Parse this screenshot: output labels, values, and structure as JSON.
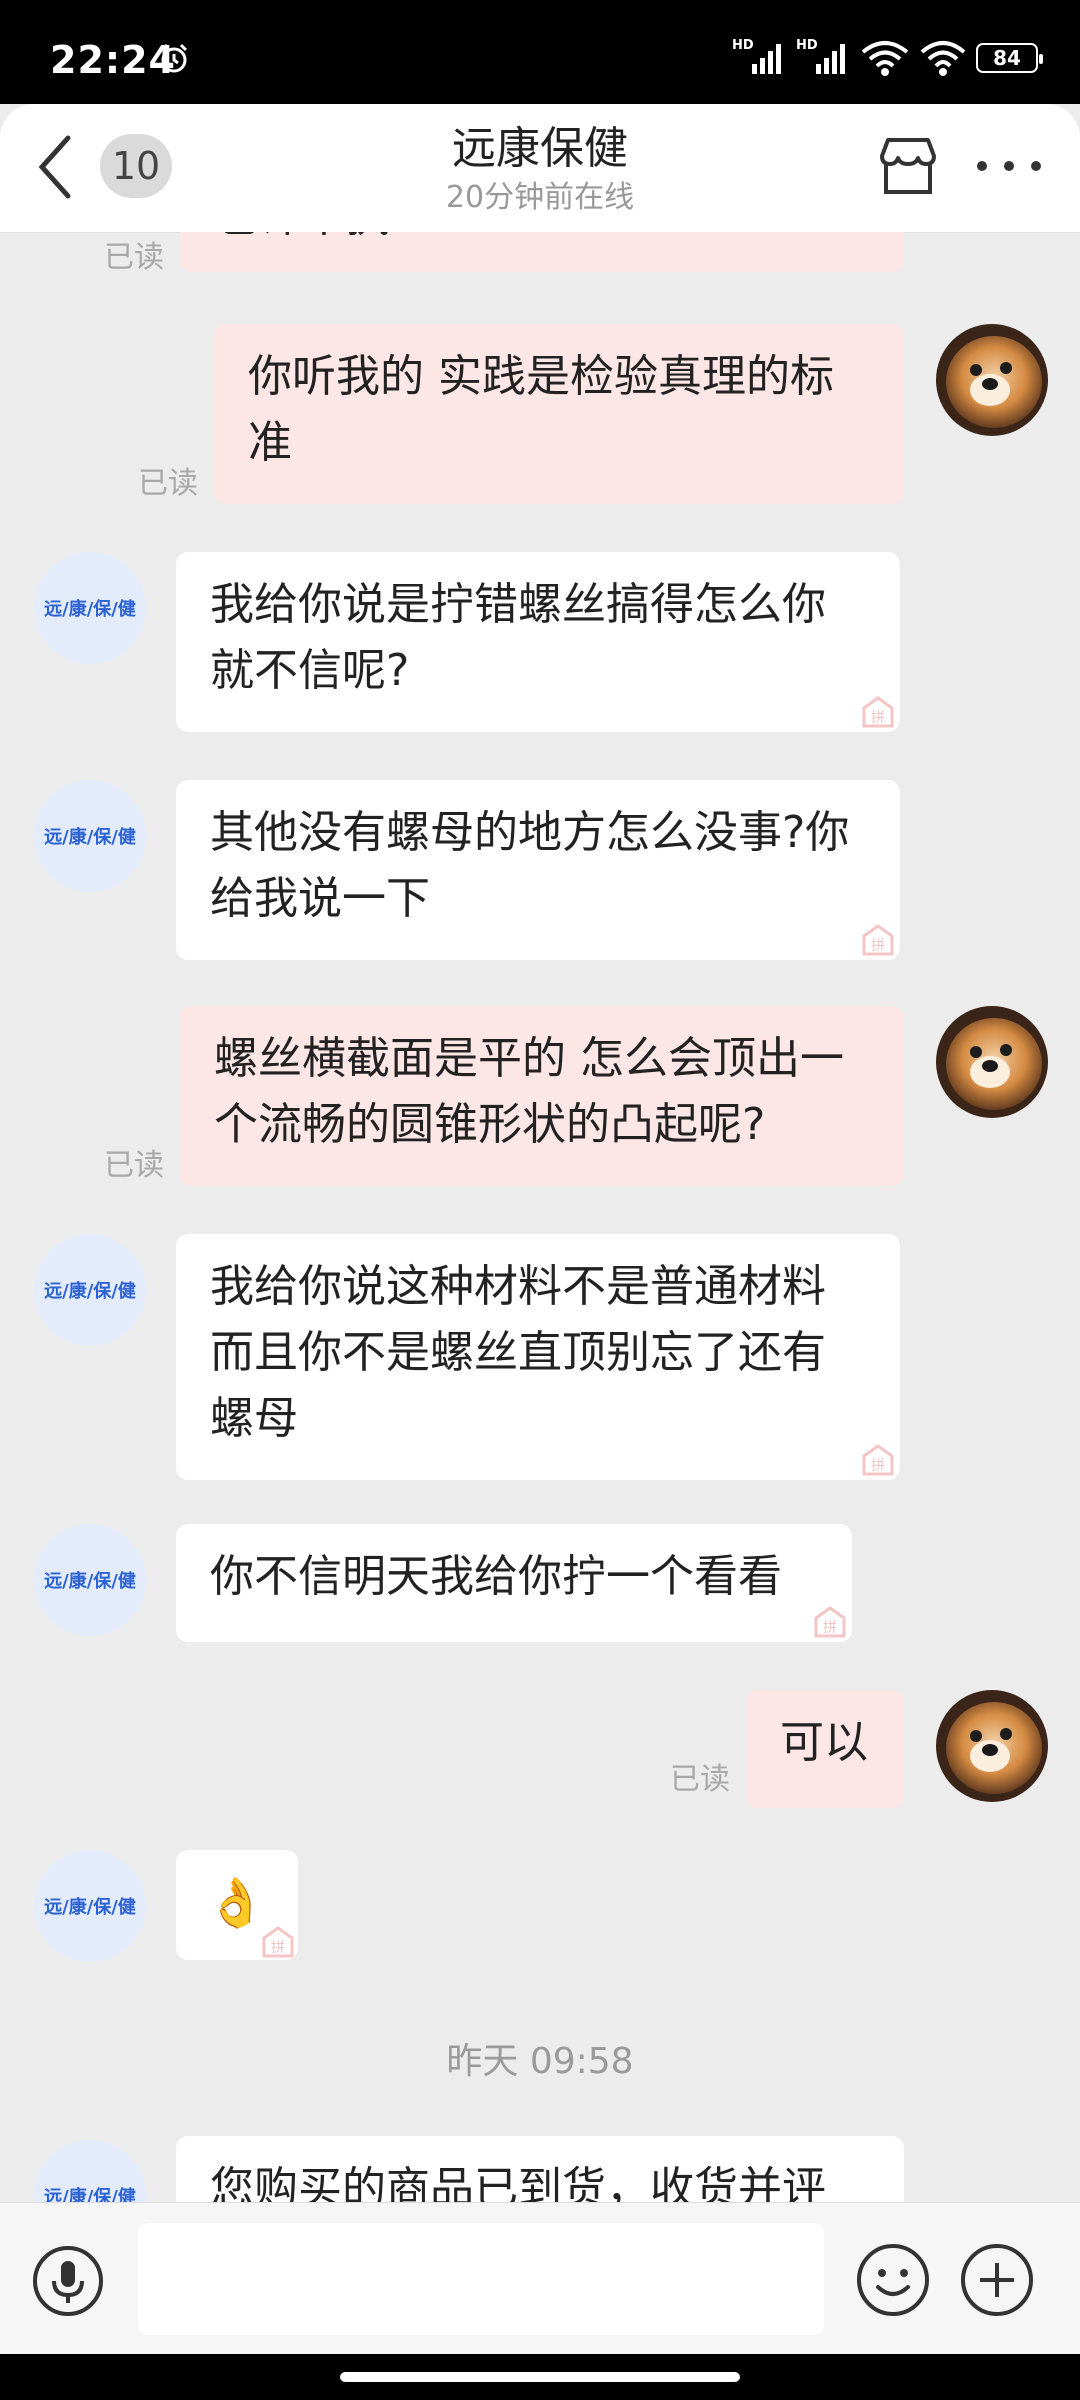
{
  "status_bar": {
    "time": "22:24",
    "signal1_label": "HD",
    "signal2_label": "HD",
    "battery": "84"
  },
  "header": {
    "unread_count": "10",
    "title": "远康保健",
    "subtitle": "20分钟前在线"
  },
  "shop_avatar_text": "远/康/保/健",
  "read_label": "已读",
  "messages": [
    {
      "sender": "me",
      "text": "也许不执?",
      "read": "已读"
    },
    {
      "sender": "me",
      "text": "你听我的 实践是检验真理的标准",
      "read": "已读"
    },
    {
      "sender": "shop",
      "text": "我给你说是拧错螺丝搞得怎么你就不信呢?"
    },
    {
      "sender": "shop",
      "text": "其他没有螺母的地方怎么没事?你给我说一下"
    },
    {
      "sender": "me",
      "text": "螺丝横截面是平的 怎么会顶出一个流畅的圆锥形状的凸起呢?",
      "read": "已读"
    },
    {
      "sender": "shop",
      "text": "我给你说这种材料不是普通材料而且你不是螺丝直顶别忘了还有螺母"
    },
    {
      "sender": "shop",
      "text": "你不信明天我给你拧一个看看"
    },
    {
      "sender": "me",
      "text": "可以",
      "read": "已读"
    },
    {
      "sender": "shop",
      "text": "👌"
    },
    {
      "sender": "shop",
      "text": "您购买的商品已到货，收货并评"
    }
  ],
  "time_separator": "昨天 09:58",
  "colors": {
    "chat_background": "#ececec",
    "my_bubble": "#fde6e6",
    "their_bubble": "#ffffff",
    "shop_avatar_bg": "#e4ecfb",
    "shop_avatar_text": "#2c62d4"
  },
  "icons": {
    "back": "chevron-left-icon",
    "shop": "store-icon",
    "more": "more-dots-icon",
    "voice": "microphone-icon",
    "emoji": "smile-icon",
    "plus": "plus-icon"
  }
}
